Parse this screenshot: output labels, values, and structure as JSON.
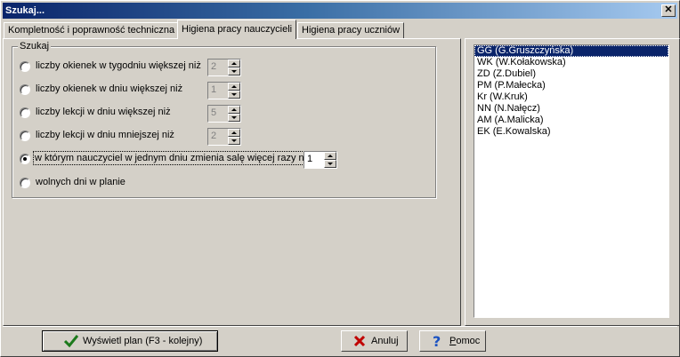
{
  "window": {
    "title": "Szukaj...",
    "close_glyph": "✕"
  },
  "tabs": [
    {
      "label": "Kompletność i poprawność techniczna",
      "active": false
    },
    {
      "label": "Higiena pracy nauczycieli",
      "active": true
    },
    {
      "label": "Higiena pracy uczniów",
      "active": false
    }
  ],
  "group": {
    "legend": "Szukaj"
  },
  "options": [
    {
      "label": "liczby okienek w tygodniu większej niż",
      "checked": false,
      "value": "2",
      "enabled": false
    },
    {
      "label": "liczby okienek w dniu większej niż",
      "checked": false,
      "value": "1",
      "enabled": false
    },
    {
      "label": "liczby lekcji w dniu większej niż",
      "checked": false,
      "value": "5",
      "enabled": false
    },
    {
      "label": "liczby lekcji w dniu mniejszej niż",
      "checked": false,
      "value": "2",
      "enabled": false
    },
    {
      "label": "w którym nauczyciel w jednym dniu zmienia salę więcej razy niż",
      "checked": true,
      "value": "1",
      "enabled": true
    },
    {
      "label": "wolnych dni w planie",
      "checked": false
    }
  ],
  "teachers": [
    "GG (G.Gruszczyńska)",
    "WK (W.Kołakowska)",
    "ZD (Z.Dubiel)",
    "PM (P.Małecka)",
    "Kr (W.Kruk)",
    "NN (N.Nałęcz)",
    "AM (A.Malicka)",
    "EK (E.Kowalska)"
  ],
  "selected_teacher_index": 0,
  "buttons": {
    "show_plan": "Wyświetl plan (F3 - kolejny)",
    "cancel": "Anuluj",
    "help_accel": "P",
    "help_rest": "omoc"
  },
  "colors": {
    "selection": "#0a246a",
    "title_gradient_start": "#0a246a",
    "face": "#d4d0c8"
  }
}
